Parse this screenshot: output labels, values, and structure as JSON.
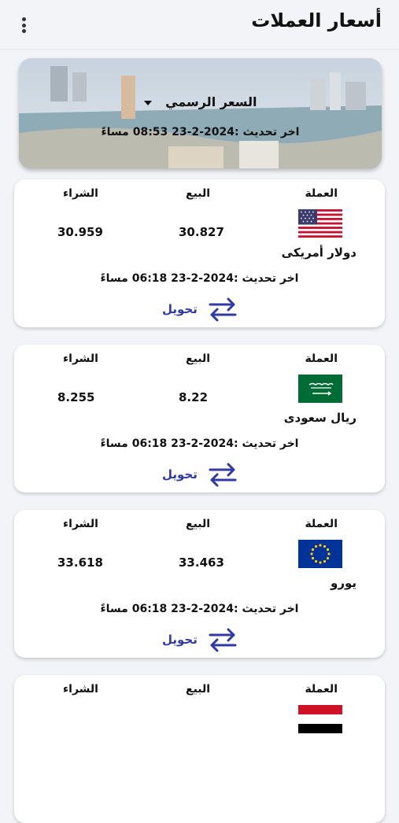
{
  "app": {
    "title": "أسعار العملات",
    "menu_icon": "more-vert-icon"
  },
  "banner": {
    "rate_type": "السعر الرسمي",
    "last_update": "اخر تحديث :2024-2-23 08:53 مساءً"
  },
  "columns": {
    "currency": "العملة",
    "sell": "البيع",
    "buy": "الشراء"
  },
  "currencies": [
    {
      "name": "دولار أمريكى",
      "flag": "us-flag-icon",
      "sell": "30.827",
      "buy": "30.959",
      "updated": "اخر تحديث :2024-2-23 06:18 مساءً",
      "convert_label": "تحويل"
    },
    {
      "name": "ريال سعودى",
      "flag": "saudi-flag-icon",
      "sell": "8.22",
      "buy": "8.255",
      "updated": "اخر تحديث :2024-2-23 06:18 مساءً",
      "convert_label": "تحويل"
    },
    {
      "name": "يورو",
      "flag": "eu-flag-icon",
      "sell": "33.463",
      "buy": "33.618",
      "updated": "اخر تحديث :2024-2-23 06:18 مساءً",
      "convert_label": "تحويل"
    }
  ],
  "colors": {
    "accent": "#2f3aa3",
    "background": "#f3f4f8"
  }
}
